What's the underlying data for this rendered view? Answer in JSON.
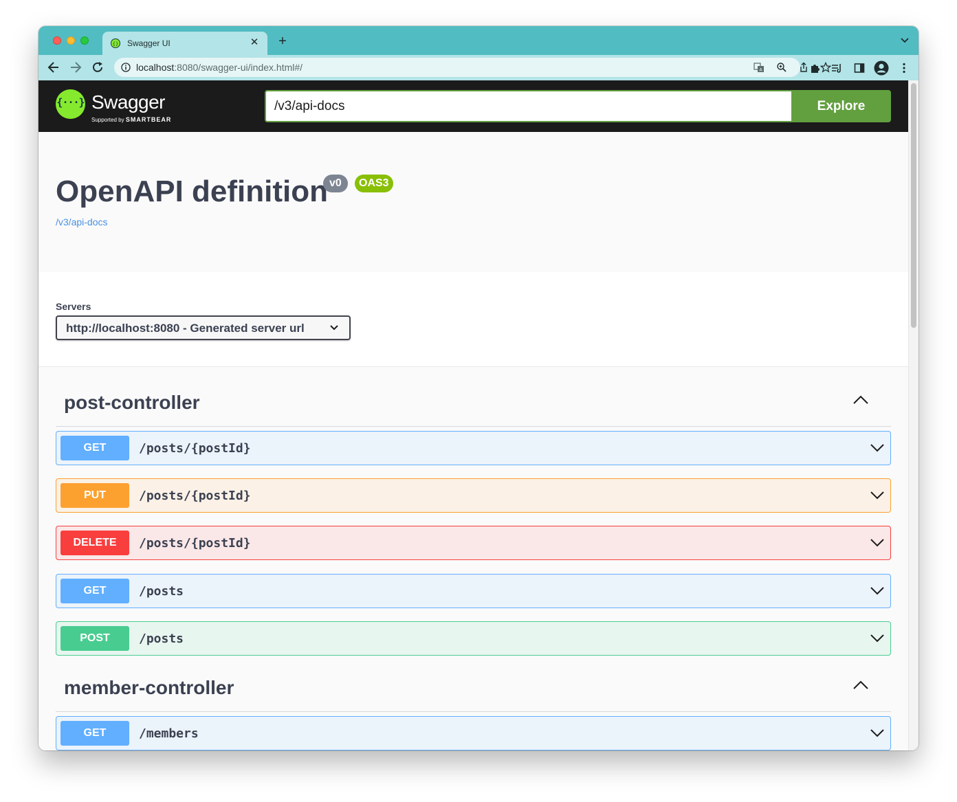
{
  "browser": {
    "tab_title": "Swagger UI",
    "url_host": "localhost",
    "url_rest": ":8080/swagger-ui/index.html#/",
    "accent_color": "#51bcc2"
  },
  "topbar": {
    "logo_word": "Swagger",
    "logo_sub_prefix": "Supported by",
    "logo_sub_brand": "SMARTBEAR",
    "spec_url": "/v3/api-docs",
    "explore_label": "Explore"
  },
  "info": {
    "title": "OpenAPI definition",
    "version_badge": "v0",
    "oas_badge": "OAS3",
    "spec_link": "/v3/api-docs"
  },
  "servers": {
    "label": "Servers",
    "selected": "http://localhost:8080 - Generated server url"
  },
  "sections": [
    {
      "name": "post-controller",
      "operations": [
        {
          "method": "GET",
          "path": "/posts/{postId}"
        },
        {
          "method": "PUT",
          "path": "/posts/{postId}"
        },
        {
          "method": "DELETE",
          "path": "/posts/{postId}"
        },
        {
          "method": "GET",
          "path": "/posts"
        },
        {
          "method": "POST",
          "path": "/posts"
        }
      ]
    },
    {
      "name": "member-controller",
      "operations": [
        {
          "method": "GET",
          "path": "/members"
        }
      ]
    }
  ],
  "colors": {
    "get": "#61affe",
    "put": "#fca130",
    "delete": "#f93e3e",
    "post": "#49cc90",
    "swagger_green": "#85ea2d",
    "explore_green": "#62a03f"
  }
}
